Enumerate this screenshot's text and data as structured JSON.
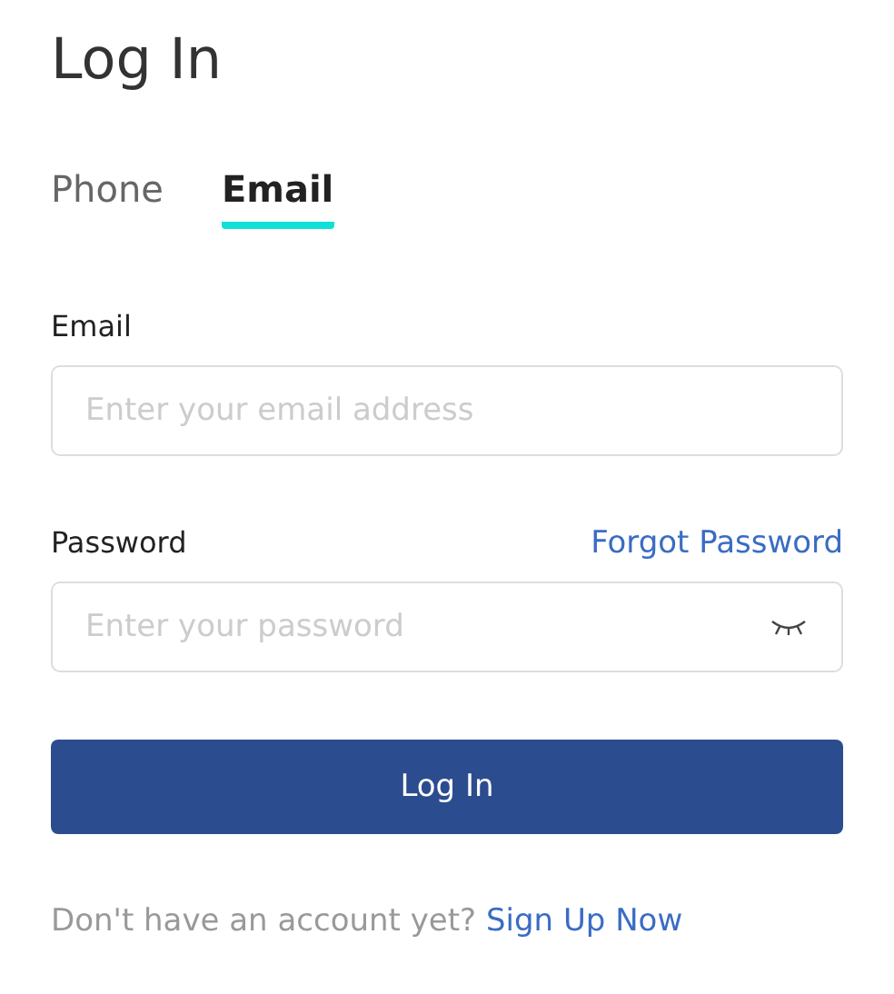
{
  "title": "Log In",
  "tabs": [
    {
      "label": "Phone",
      "selected": false
    },
    {
      "label": "Email",
      "selected": true
    }
  ],
  "email": {
    "label": "Email",
    "placeholder": "Enter your email address"
  },
  "password": {
    "label": "Password",
    "placeholder": "Enter your password",
    "forgot_link": "Forgot Password",
    "visible": false
  },
  "submit": "Log In",
  "footer": {
    "prompt": "Don't have an account yet?",
    "link": "Sign Up Now"
  }
}
